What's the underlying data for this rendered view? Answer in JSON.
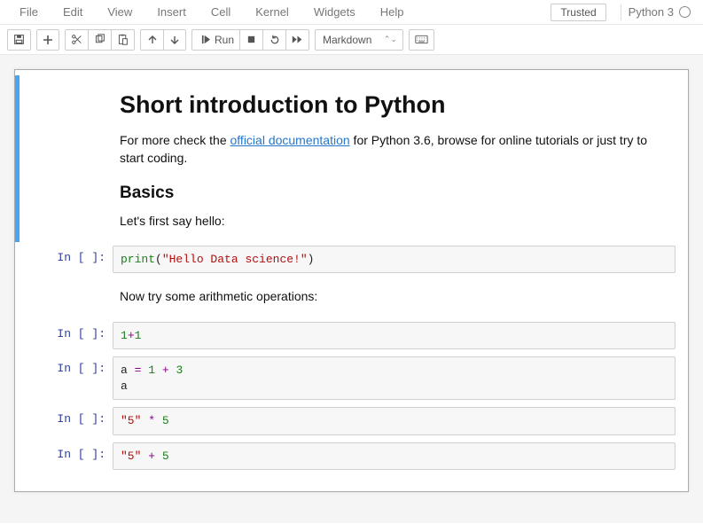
{
  "menu": {
    "items": [
      "File",
      "Edit",
      "View",
      "Insert",
      "Cell",
      "Kernel",
      "Widgets",
      "Help"
    ],
    "trusted_label": "Trusted",
    "kernel_label": "Python 3"
  },
  "toolbar": {
    "save_icon": "save",
    "add_icon": "plus",
    "cut_icon": "scissors",
    "copy_icon": "copy",
    "paste_icon": "paste",
    "up_icon": "arrow-up",
    "down_icon": "arrow-down",
    "run_label": "Run",
    "stop_icon": "stop",
    "restart_icon": "restart",
    "ff_icon": "fast-forward",
    "celltype_value": "Markdown",
    "palette_icon": "keyboard"
  },
  "cells": [
    {
      "type": "markdown",
      "selected": true,
      "rendered": {
        "h1": "Short introduction to Python",
        "p1_pre": "For more check the ",
        "p1_link": "official documentation",
        "p1_post": " for Python 3.6, browse for online tutorials or just try to start coding.",
        "h2": "Basics",
        "p2": "Let's first say hello:"
      }
    },
    {
      "type": "code",
      "prompt": "In [ ]:",
      "tokens": [
        {
          "cls": "tok-fn",
          "t": "print"
        },
        {
          "cls": "",
          "t": "("
        },
        {
          "cls": "tok-str",
          "t": "\"Hello Data science!\""
        },
        {
          "cls": "",
          "t": ")"
        }
      ]
    },
    {
      "type": "markdown",
      "rendered": {
        "p_single": "Now try some arithmetic operations:"
      }
    },
    {
      "type": "code",
      "prompt": "In [ ]:",
      "tokens": [
        {
          "cls": "tok-num",
          "t": "1"
        },
        {
          "cls": "tok-op",
          "t": "+"
        },
        {
          "cls": "tok-num",
          "t": "1"
        }
      ]
    },
    {
      "type": "code",
      "prompt": "In [ ]:",
      "tokens": [
        {
          "cls": "tok-var",
          "t": "a "
        },
        {
          "cls": "tok-op",
          "t": "="
        },
        {
          "cls": "",
          "t": " "
        },
        {
          "cls": "tok-num",
          "t": "1"
        },
        {
          "cls": "",
          "t": " "
        },
        {
          "cls": "tok-op",
          "t": "+"
        },
        {
          "cls": "",
          "t": " "
        },
        {
          "cls": "tok-num",
          "t": "3"
        },
        {
          "cls": "",
          "t": "\n"
        },
        {
          "cls": "tok-var",
          "t": "a"
        }
      ]
    },
    {
      "type": "code",
      "prompt": "In [ ]:",
      "tokens": [
        {
          "cls": "tok-str",
          "t": "\"5\""
        },
        {
          "cls": "",
          "t": " "
        },
        {
          "cls": "tok-op",
          "t": "*"
        },
        {
          "cls": "",
          "t": " "
        },
        {
          "cls": "tok-num",
          "t": "5"
        }
      ]
    },
    {
      "type": "code",
      "prompt": "In [ ]:",
      "tokens": [
        {
          "cls": "tok-str",
          "t": "\"5\""
        },
        {
          "cls": "",
          "t": " "
        },
        {
          "cls": "tok-op",
          "t": "+"
        },
        {
          "cls": "",
          "t": " "
        },
        {
          "cls": "tok-num",
          "t": "5"
        }
      ]
    }
  ]
}
